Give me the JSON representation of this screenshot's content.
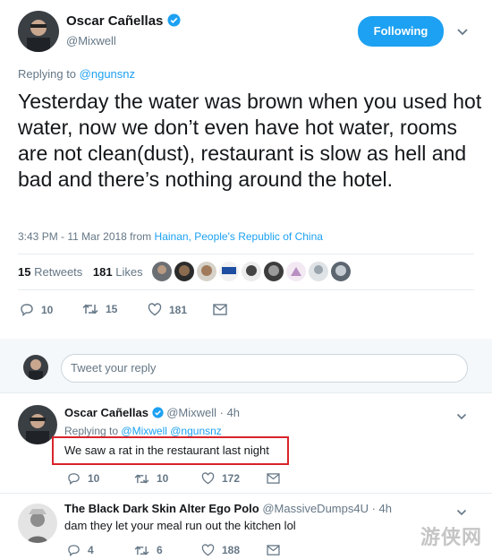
{
  "main_tweet": {
    "author_name": "Oscar Cañellas",
    "author_handle": "@Mixwell",
    "follow_label": "Following",
    "replying_prefix": "Replying to",
    "replying_to": "@ngunsnz",
    "text": "Yesterday the water was brown when you used hot water, now we don’t even have hot water, rooms are not clean(dust), restaurant is slow as hell and bad and there’s nothing around the hotel.",
    "timestamp": "3:43 PM - 11 Mar 2018 from",
    "location": "Hainan, People's Republic of China",
    "retweets_count": "15",
    "retweets_label": "Retweets",
    "likes_count": "181",
    "likes_label": "Likes",
    "actions": {
      "replies": "10",
      "retweets": "15",
      "likes": "181"
    }
  },
  "compose": {
    "placeholder": "Tweet your reply"
  },
  "replies": [
    {
      "author_name": "Oscar Cañellas",
      "author_handle": "@Mixwell",
      "time": "· 4h",
      "replying_prefix": "Replying to",
      "replying_to": "@Mixwell @ngunsnz",
      "text": "We saw a rat in the restaurant last night",
      "actions": {
        "replies": "10",
        "retweets": "10",
        "likes": "172"
      }
    },
    {
      "author_name": "The Black Dark Skin Alter Ego Polo",
      "author_handle": "@MassiveDumps4U",
      "time": "· 4h",
      "text": "dam they let your meal run out the kitchen lol",
      "actions": {
        "replies": "4",
        "retweets": "6",
        "likes": "188"
      }
    }
  ],
  "watermark": "游侠网",
  "colors": {
    "accent": "#1da1f2",
    "text": "#14171a",
    "muted": "#657786",
    "highlight": "#d9232a"
  }
}
